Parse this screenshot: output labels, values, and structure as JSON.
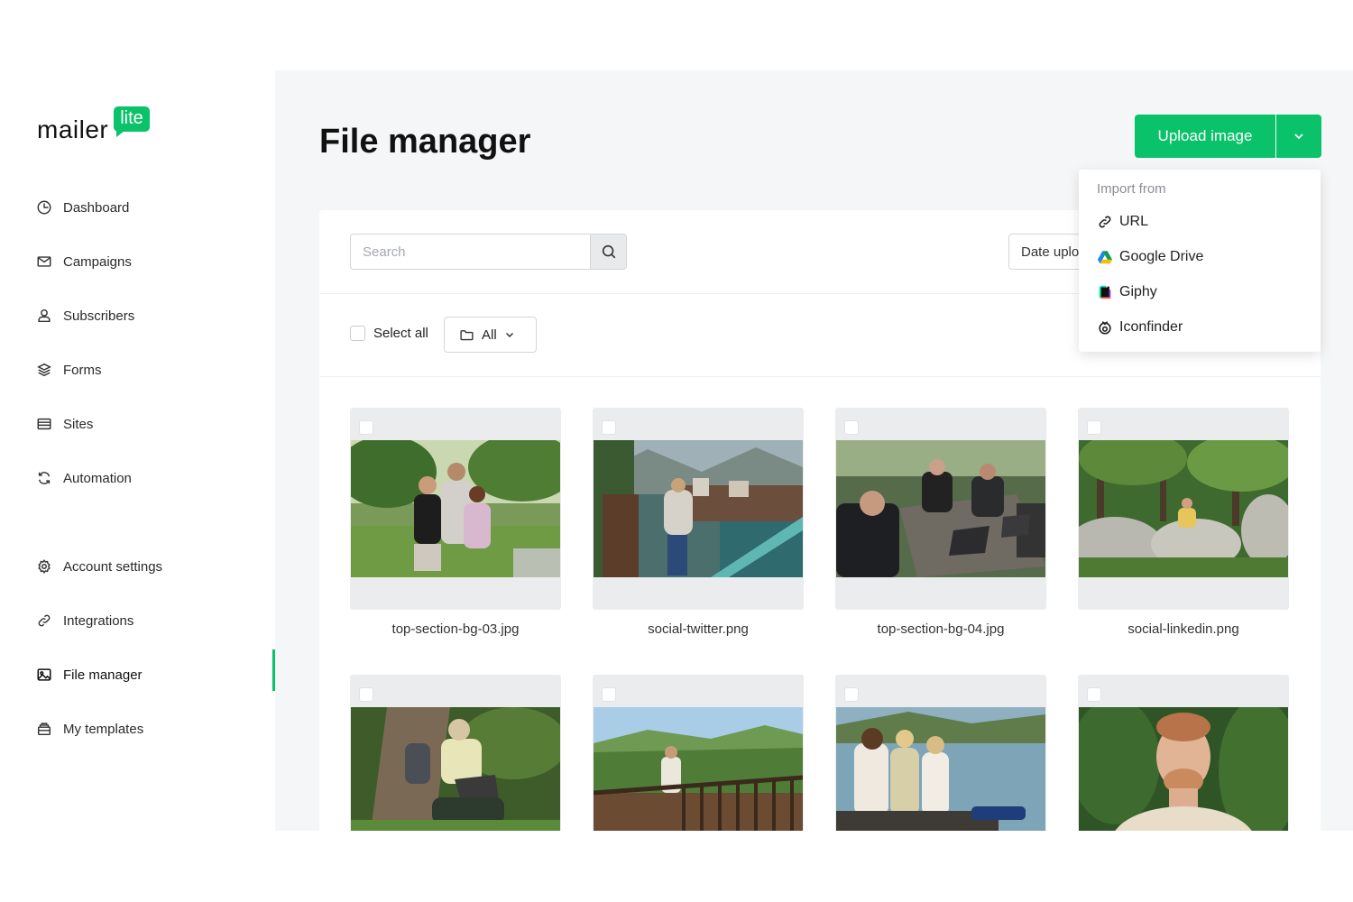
{
  "brand": {
    "word": "mailer",
    "badge": "lite",
    "accent": "#09c269"
  },
  "sidebar": {
    "items": [
      {
        "label": "Dashboard",
        "icon": "dashboard-icon"
      },
      {
        "label": "Campaigns",
        "icon": "envelope-icon"
      },
      {
        "label": "Subscribers",
        "icon": "user-icon"
      },
      {
        "label": "Forms",
        "icon": "layers-icon"
      },
      {
        "label": "Sites",
        "icon": "browser-icon"
      },
      {
        "label": "Automation",
        "icon": "refresh-icon"
      },
      {
        "label": "Account settings",
        "icon": "gear-icon"
      },
      {
        "label": "Integrations",
        "icon": "link-icon"
      },
      {
        "label": "File manager",
        "icon": "image-icon",
        "active": true
      },
      {
        "label": "My templates",
        "icon": "template-icon"
      }
    ]
  },
  "header": {
    "title": "File manager",
    "upload_label": "Upload image"
  },
  "toolbar": {
    "search_placeholder": "Search",
    "sort_label": "Date uploaded",
    "select_all_label": "Select all",
    "folder_label": "All"
  },
  "import_menu": {
    "heading": "Import from",
    "items": [
      {
        "label": "URL",
        "icon": "link-icon"
      },
      {
        "label": "Google Drive",
        "icon": "google-drive-icon"
      },
      {
        "label": "Giphy",
        "icon": "giphy-icon"
      },
      {
        "label": "Iconfinder",
        "icon": "iconfinder-icon"
      }
    ]
  },
  "files": [
    {
      "name": "top-section-bg-03.jpg"
    },
    {
      "name": "social-twitter.png"
    },
    {
      "name": "top-section-bg-04.jpg"
    },
    {
      "name": "social-linkedin.png"
    },
    {
      "name": ""
    },
    {
      "name": ""
    },
    {
      "name": ""
    },
    {
      "name": ""
    }
  ]
}
